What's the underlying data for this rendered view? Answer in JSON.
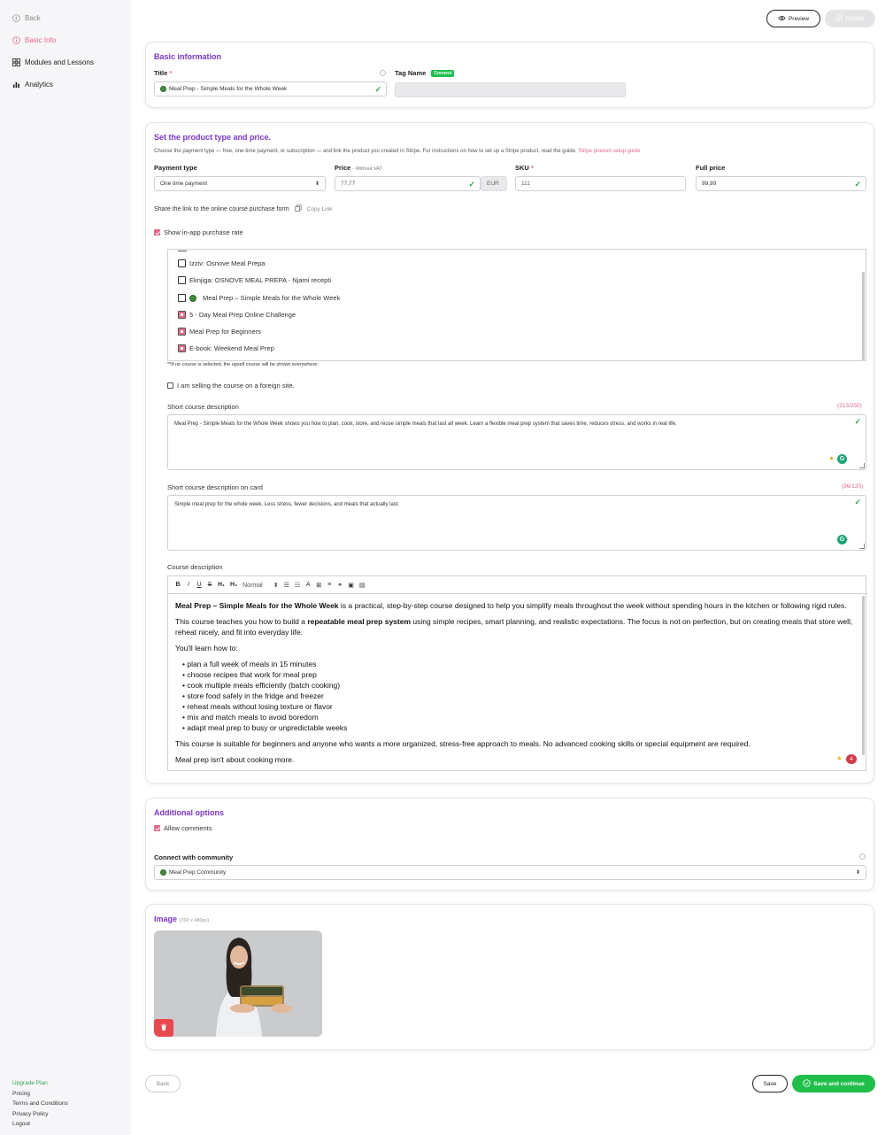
{
  "sidebar": {
    "back": "Back",
    "basic_info": "Basic Info",
    "modules": "Modules and Lessons",
    "analytics": "Analytics",
    "footer": {
      "upgrade": "Upgrade Plan",
      "pricing": "Pricing",
      "terms": "Terms and Conditions",
      "privacy": "Privacy Policy",
      "logout": "Logout"
    }
  },
  "header": {
    "preview": "Preview",
    "publish": "Publish"
  },
  "basic": {
    "title": "Basic information",
    "title_label": "Title",
    "req": "*",
    "title_value": "Meal Prep - Simple Meals for the Whole Week",
    "tag_label": "Tag Name",
    "connect_badge": "Connect"
  },
  "pricing": {
    "title": "Set the product type and price.",
    "description": "Choose the payment type — free, one-time payment, or subscription — and link the product you created in Stripe. For instructions on how to set up a Stripe product, read the guide.",
    "guide_link": "Stripe product setup guide",
    "payment_type_label": "Payment type",
    "payment_type_value": "One time payment",
    "price_label": "Price",
    "price_sub": "- Without VAT",
    "price_value": "77,77",
    "currency": "EUR",
    "sku_label": "SKU",
    "sku_value": "111",
    "full_price_label": "Full price",
    "full_price_value": "99,99",
    "share_text": "Share the link to the online course purchase form",
    "copy_link": "Copy Link",
    "show_rate": "Show in-app purchase rate",
    "upsell_items": [
      {
        "label": "Izziv: Osnove Meal Prepa",
        "checked": false
      },
      {
        "label": "Eknjiga: OSNOVE MEAL PREPA - Njami recepti",
        "checked": false
      },
      {
        "label": "Meal Prep – Simple Meals for the Whole Week",
        "checked": false
      },
      {
        "label": "5 - Day Meal Prep Online Challenge",
        "checked": true
      },
      {
        "label": "Meal Prep for Beginners",
        "checked": true
      },
      {
        "label": "E-book: Weekend Meal Prep",
        "checked": true
      }
    ],
    "upsell_note": "**If no course is selected, the upsell course will be shown everywhere.",
    "foreign_site": "I am selling the course on a foreign site.",
    "short_desc_label": "Short course description",
    "short_desc_count": "(213/250)",
    "short_desc_value": "Meal Prep - Simple Meals for the Whole Week shows you how to plan, cook, store, and reuse simple meals that last all week. Learn a flexible meal prep system that saves time, reduces stress, and works in real life.",
    "card_desc_label": "Short course description on card",
    "card_desc_count": "(96/120)",
    "card_desc_value": "Simple meal prep for the whole week. Less stress, fewer decisions, and meals that actually last.",
    "course_desc_label": "Course description",
    "toolbar_normal": "Normal",
    "editor": {
      "p1_bold": "Meal Prep – Simple Meals for the Whole Week",
      "p1_rest": " is a practical, step-by-step course designed to help you simplify meals throughout the week without spending hours in the kitchen or following rigid rules.",
      "p2_a": "This course teaches you how to build a ",
      "p2_bold": "repeatable meal prep system",
      "p2_b": " using simple recipes, smart planning, and realistic expectations. The focus is not on perfection, but on creating meals that store well, reheat nicely, and fit into everyday life.",
      "p3": "You'll learn how to:",
      "bullets": [
        "plan a full week of meals in 15 minutes",
        "choose recipes that work for meal prep",
        "cook multiple meals efficiently (batch cooking)",
        "store food safely in the fridge and freezer",
        "reheat meals without losing texture or flavor",
        "mix and match meals to avoid boredom",
        "adapt meal prep to busy or unpredictable weeks"
      ],
      "p4": "This course is suitable for beginners and anyone who wants a more organized, stress-free approach to meals. No advanced cooking skills or special equipment are required.",
      "p5": "Meal prep isn't about cooking more."
    }
  },
  "additional": {
    "title": "Additional options",
    "allow_comments": "Allow comments",
    "community_label": "Connect with community",
    "community_value": "Meal Prep Community"
  },
  "image": {
    "title": "Image",
    "size": "(760 x 480px)"
  },
  "footer": {
    "back": "Back",
    "save": "Save",
    "save_continue": "Save and continue"
  },
  "colors": {
    "accent": "#7a35d8",
    "pink": "#e8678a",
    "green": "#1fbf4a"
  }
}
